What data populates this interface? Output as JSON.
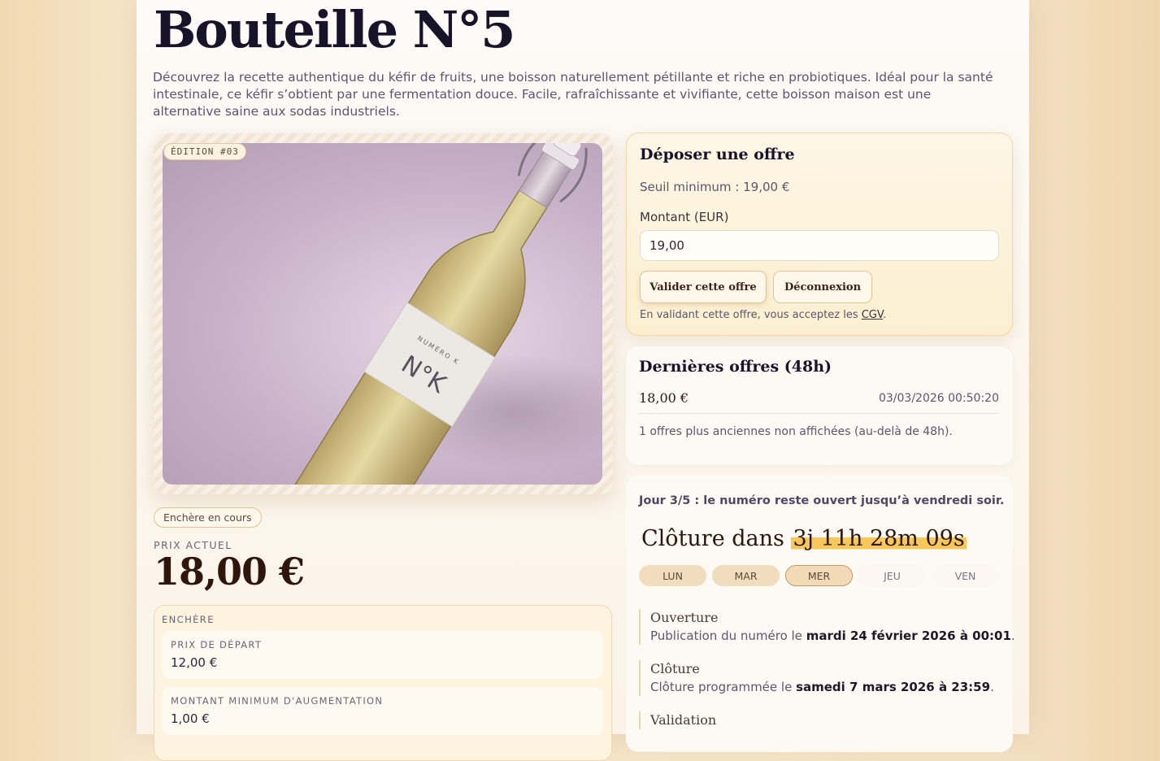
{
  "product": {
    "title": "Bouteille N°5",
    "description": "Découvrez la recette authentique du kéfir de fruits, une boisson naturellement pétillante et riche en probiotiques. Idéal pour la santé intestinale, ce kéfir s’obtient par une fermentation douce. Facile, rafraîchissante et vivifiante, cette boisson maison est une alternative saine aux sodas industriels.",
    "edition_badge": "ÉDITION #03",
    "label_small": "NUMÉRO K",
    "label_big": "N°K"
  },
  "auction": {
    "status": "Enchère en cours",
    "current_price_label": "PRIX ACTUEL",
    "current_price": "18,00 €",
    "section_label": "ENCHÈRE",
    "start_price_label": "PRIX DE DÉPART",
    "start_price": "12,00 €",
    "min_increment_label": "MONTANT MINIMUM D'AUGMENTATION",
    "min_increment": "1,00 €"
  },
  "offer_form": {
    "title": "Déposer une offre",
    "min_threshold": "Seuil minimum : 19,00 €",
    "amount_label": "Montant (EUR)",
    "amount_value": "19,00",
    "submit_label": "Valider cette offre",
    "logout_label": "Déconnexion",
    "legal_prefix": "En validant cette offre, vous acceptez les ",
    "legal_link": "CGV",
    "legal_suffix": "."
  },
  "recent_offers": {
    "title": "Dernières offres (48h)",
    "items": [
      {
        "amount": "18,00 €",
        "time": "03/03/2026 00:50:20"
      }
    ],
    "older_note": "1 offres plus anciennes non affichées (au-delà de 48h)."
  },
  "schedule": {
    "day_note": "Jour 3/5 : le numéro reste ouvert jusqu’à vendredi soir.",
    "countdown_prefix": "Clôture dans",
    "countdown_value": "3j 11h 28m 09s",
    "days": [
      "LUN",
      "MAR",
      "MER",
      "JEU",
      "VEN"
    ],
    "current_day_index": 2,
    "timeline": [
      {
        "title": "Ouverture",
        "text_prefix": "Publication du numéro le ",
        "text_bold": "mardi 24 février 2026 à 00:01",
        "text_suffix": "."
      },
      {
        "title": "Clôture",
        "text_prefix": "Clôture programmée le ",
        "text_bold": "samedi 7 mars 2026 à 23:59",
        "text_suffix": "."
      },
      {
        "title": "Validation",
        "text_prefix": "",
        "text_bold": "",
        "text_suffix": ""
      }
    ]
  },
  "colors": {
    "accent": "#f7c75a",
    "ink": "#17142a",
    "price": "#2e160c",
    "card_warm": "#fdf3df"
  }
}
